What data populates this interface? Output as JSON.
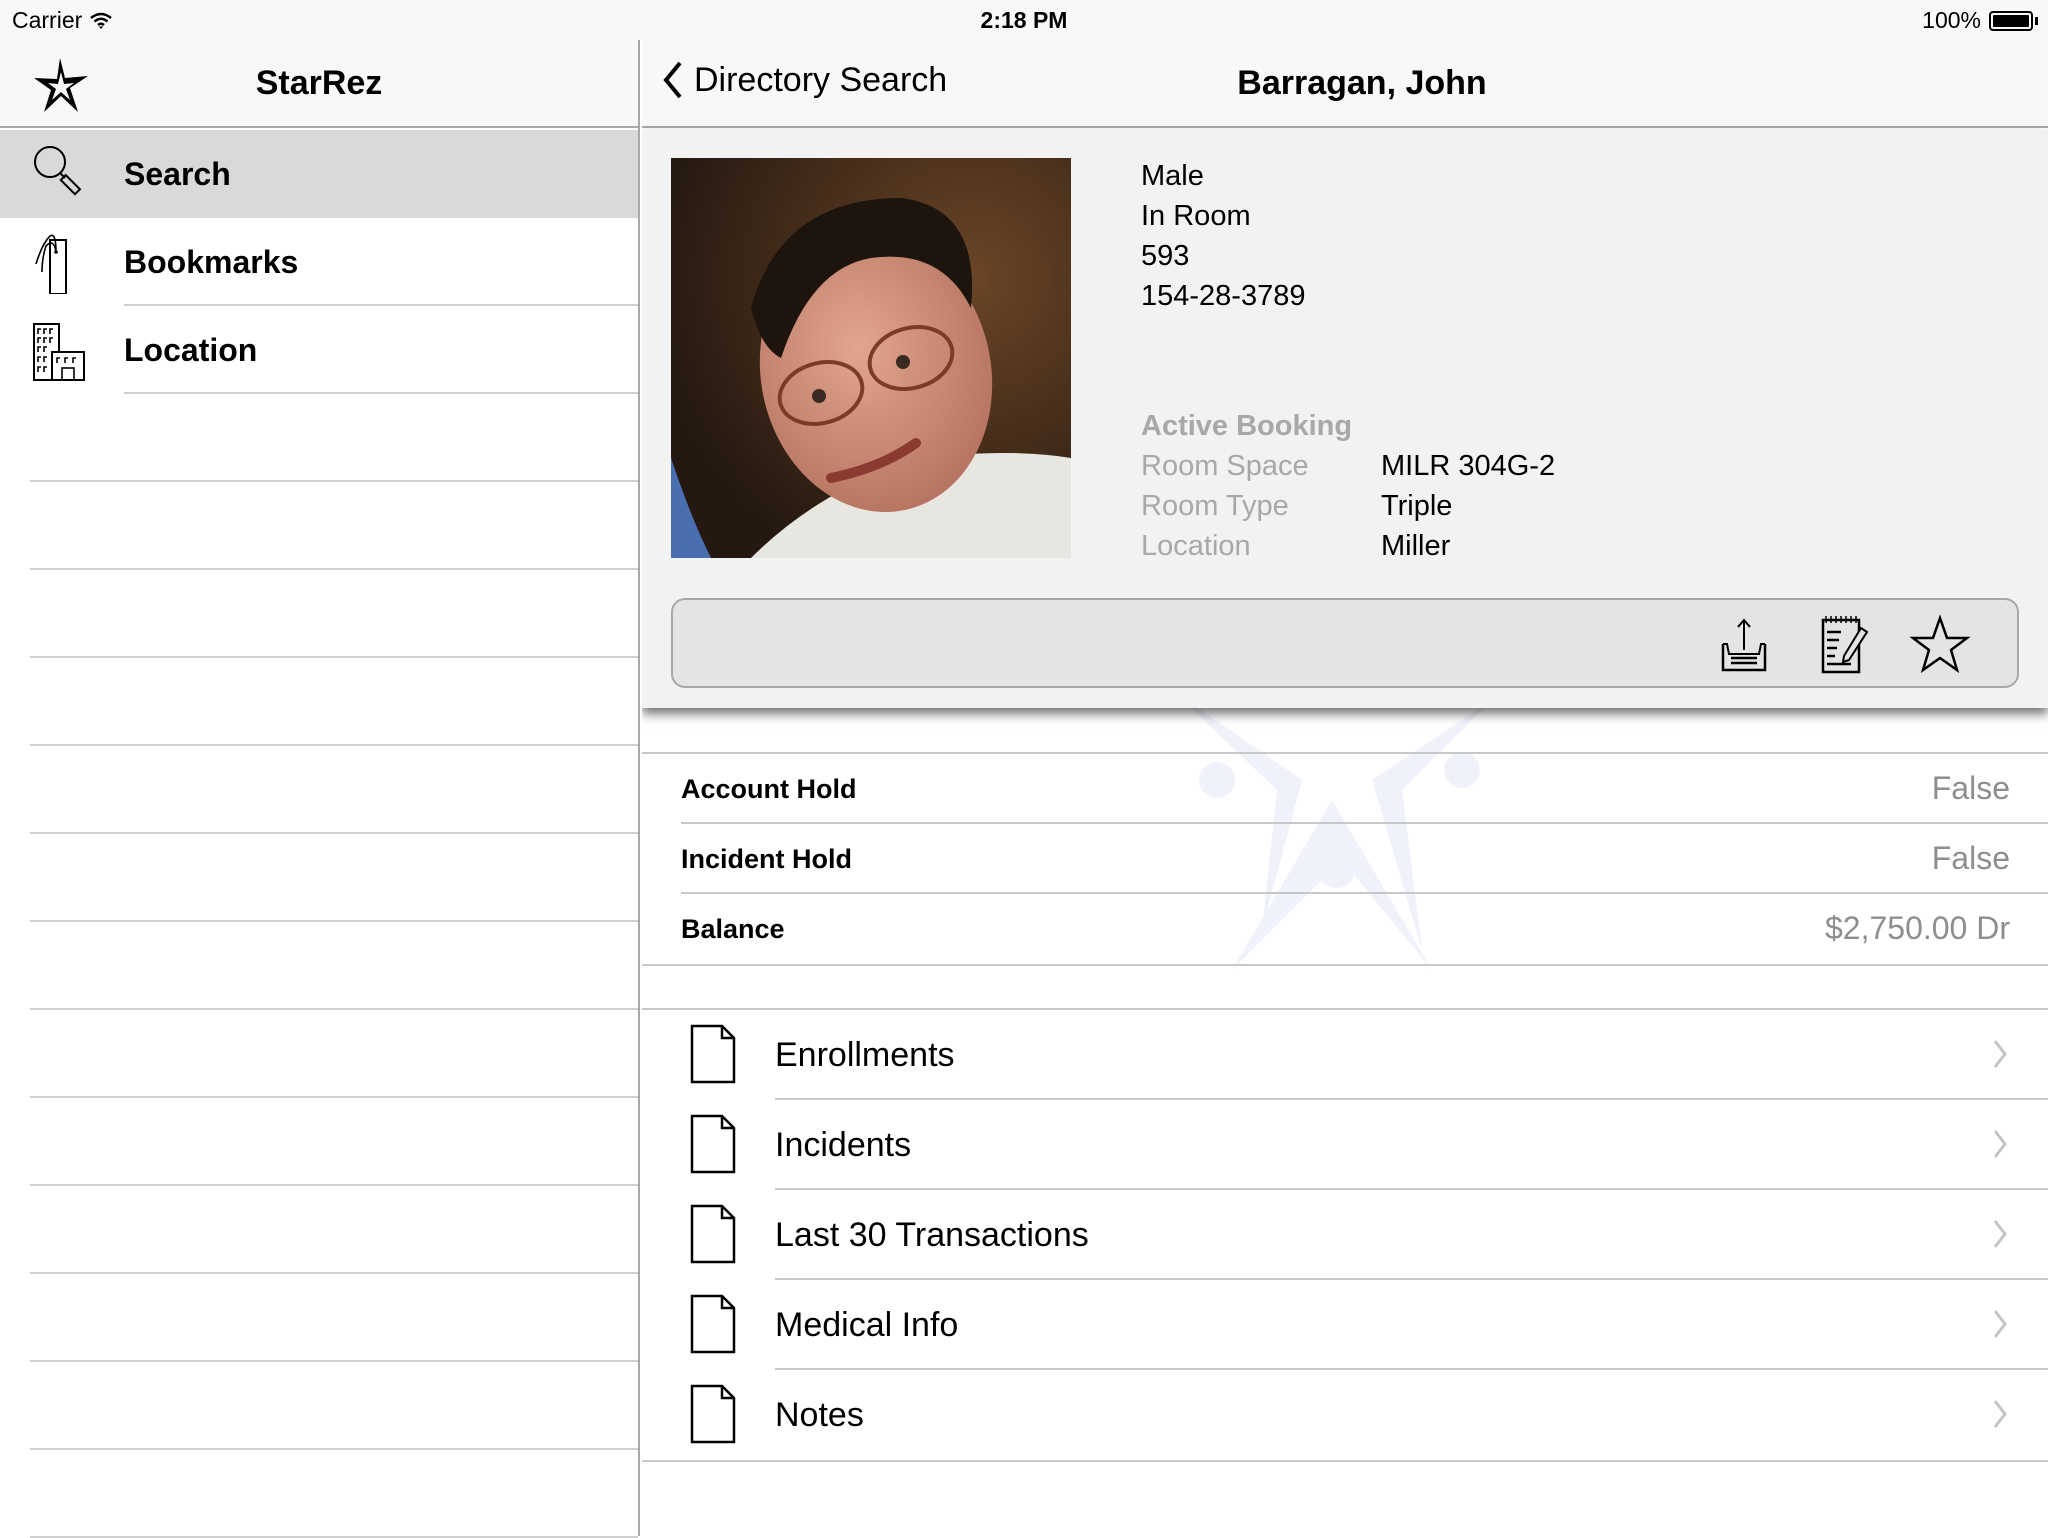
{
  "status_bar": {
    "carrier": "Carrier",
    "time": "2:18 PM",
    "battery_label": "100%",
    "battery_level": 1.0
  },
  "sidebar": {
    "title": "StarRez",
    "logo_icon": "star-logo-icon",
    "items": [
      {
        "label": "Search",
        "icon": "search-icon",
        "selected": true
      },
      {
        "label": "Bookmarks",
        "icon": "bookmark-icon",
        "selected": false
      },
      {
        "label": "Location",
        "icon": "building-icon",
        "selected": false
      }
    ]
  },
  "nav": {
    "back_label": "Directory Search",
    "title": "Barragan, John"
  },
  "profile": {
    "photo_alt": "Profile photo of John Barragan",
    "gender": "Male",
    "status": "In Room",
    "id": "593",
    "ssn": "154-28-3789",
    "booking": {
      "heading": "Active Booking",
      "rows": [
        {
          "label": "Room Space",
          "value": "MILR 304G-2"
        },
        {
          "label": "Room Type",
          "value": "Triple"
        },
        {
          "label": "Location",
          "value": "Miller"
        }
      ]
    },
    "actions": [
      {
        "name": "share",
        "icon": "share-upload-icon"
      },
      {
        "name": "notes",
        "icon": "notepad-edit-icon"
      },
      {
        "name": "bookmark",
        "icon": "star-outline-icon"
      }
    ]
  },
  "holds": [
    {
      "label": "Account Hold",
      "value": "False"
    },
    {
      "label": "Incident Hold",
      "value": "False"
    },
    {
      "label": "Balance",
      "value": "$2,750.00 Dr"
    }
  ],
  "links": [
    {
      "label": "Enrollments",
      "icon": "document-icon"
    },
    {
      "label": "Incidents",
      "icon": "document-icon"
    },
    {
      "label": "Last 30 Transactions",
      "icon": "document-icon"
    },
    {
      "label": "Medical Info",
      "icon": "document-icon"
    },
    {
      "label": "Notes",
      "icon": "document-icon"
    }
  ],
  "colors": {
    "selected_row": "#d9d9d9",
    "secondary_text": "#a8a8a8",
    "value_text": "#8e8e8e",
    "watermark": "#3050d0"
  }
}
